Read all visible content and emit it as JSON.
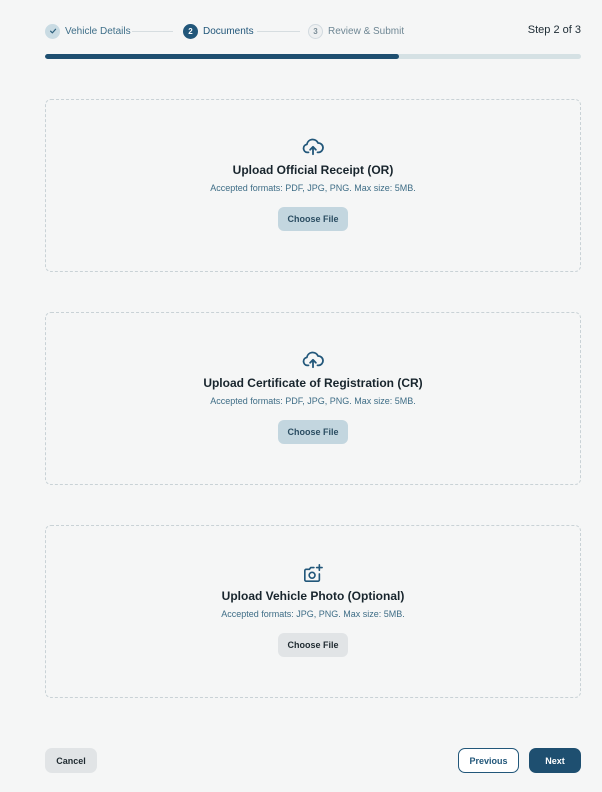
{
  "stepper": {
    "steps": [
      {
        "number": "",
        "label": "Vehicle Details",
        "status": "completed"
      },
      {
        "number": "2",
        "label": "Documents",
        "status": "active"
      },
      {
        "number": "3",
        "label": "Review & Submit",
        "status": "upcoming"
      }
    ],
    "step_count": "Step 2 of 3"
  },
  "progress": {
    "fraction": 0.66
  },
  "uploads": [
    {
      "icon": "cloud-upload-icon",
      "title": "Upload Official Receipt (OR)",
      "description": "Accepted formats: PDF, JPG, PNG. Max size: 5MB.",
      "button": "Choose File"
    },
    {
      "icon": "cloud-upload-icon",
      "title": "Upload Certificate of Registration (CR)",
      "description": "Accepted formats: PDF, JPG, PNG. Max size: 5MB.",
      "button": "Choose File"
    },
    {
      "icon": "add-photo-icon",
      "title": "Upload Vehicle Photo (Optional)",
      "description": "Accepted formats: JPG, PNG. Max size: 5MB.",
      "button": "Choose File"
    }
  ],
  "footer": {
    "cancel": "Cancel",
    "previous": "Previous",
    "next": "Next"
  },
  "colors": {
    "primary": "#1e4f70",
    "completed_step": "#c9dbe3",
    "progress_track": "#d5e1e4",
    "page_background": "#f5f6f6"
  }
}
